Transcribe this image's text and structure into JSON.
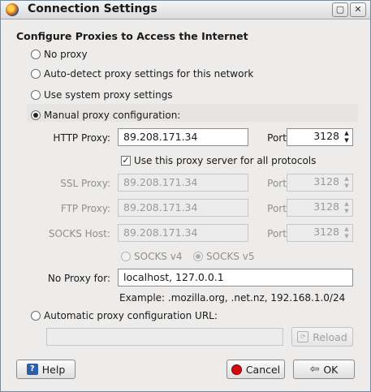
{
  "window": {
    "title": "Connection Settings",
    "restore_glyph": "▢",
    "close_glyph": "✕"
  },
  "group_title": "Configure Proxies to Access the Internet",
  "options": {
    "no_proxy": "No proxy",
    "auto_detect": "Auto-detect proxy settings for this network",
    "system": "Use system proxy settings",
    "manual": "Manual proxy configuration:",
    "automatic_url": "Automatic proxy configuration URL:"
  },
  "selected_option": "manual",
  "http": {
    "label": "HTTP Proxy:",
    "value": "89.208.171.34",
    "port_label": "Port:",
    "port": "3128"
  },
  "use_for_all": {
    "label": "Use this proxy server for all protocols",
    "checked": true
  },
  "ssl": {
    "label": "SSL Proxy:",
    "value": "89.208.171.34",
    "port_label": "Port:",
    "port": "3128"
  },
  "ftp": {
    "label": "FTP Proxy:",
    "value": "89.208.171.34",
    "port_label": "Port:",
    "port": "3128"
  },
  "socks": {
    "label": "SOCKS Host:",
    "value": "89.208.171.34",
    "port_label": "Port:",
    "port": "3128"
  },
  "socks_version": {
    "v4": "SOCKS v4",
    "v5": "SOCKS v5",
    "selected": "v5"
  },
  "no_proxy_for": {
    "label": "No Proxy for:",
    "value": "localhost, 127.0.0.1",
    "example": "Example: .mozilla.org, .net.nz, 192.168.1.0/24"
  },
  "auto_url": {
    "value": "",
    "reload_label": "Reload"
  },
  "buttons": {
    "help": "Help",
    "cancel": "Cancel",
    "ok": "OK"
  },
  "icons": {
    "app": "firefox-icon",
    "help": "help-icon",
    "cancel": "cancel-icon",
    "ok": "ok-arrow-icon",
    "reload": "reload-icon"
  },
  "colors": {
    "cancel_icon": "#d10b0b",
    "help_icon": "#2f5ea8",
    "background": "#edeceb"
  }
}
